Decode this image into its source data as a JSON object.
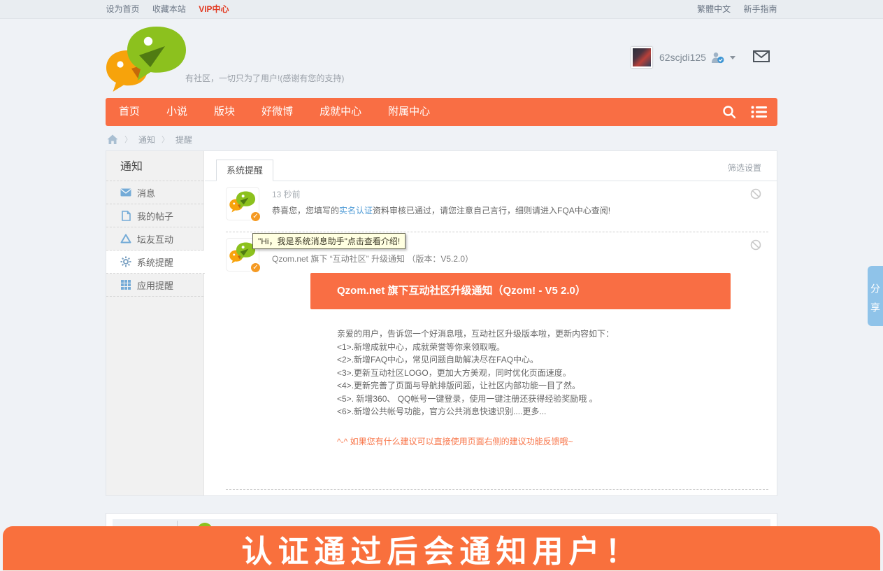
{
  "colors": {
    "accent_orange": "#f96e44",
    "link_blue": "#4f9bd6",
    "sidebar_icon_blue": "#74abd7",
    "share_tab_blue": "#8fc3e9",
    "vip_red": "#e23a21",
    "tooltip_bg": "#ffffe1",
    "page_bg": "#eff2f6"
  },
  "topbar": {
    "links_left": [
      "设为首页",
      "收藏本站",
      "VIP中心"
    ],
    "links_right": [
      "繁體中文",
      "新手指南"
    ]
  },
  "header": {
    "tagline": "有社区，一切只为了用户!(感谢有您的支持)",
    "username": "62scjdi125"
  },
  "nav": {
    "items": [
      "首页",
      "小说",
      "版块",
      "好微博",
      "成就中心",
      "附属中心"
    ]
  },
  "breadcrumb": {
    "level1": "通知",
    "level2": "提醒"
  },
  "sidebar": {
    "title": "通知",
    "items": [
      {
        "label": "消息",
        "icon": "envelope-icon",
        "active": false
      },
      {
        "label": "我的帖子",
        "icon": "document-icon",
        "active": false
      },
      {
        "label": "坛友互动",
        "icon": "recycle-icon",
        "active": false
      },
      {
        "label": "系统提醒",
        "icon": "gear-icon",
        "active": true
      },
      {
        "label": "应用提醒",
        "icon": "grid-icon",
        "active": false
      }
    ]
  },
  "main": {
    "tab_label": "系统提醒",
    "filter_label": "筛选设置",
    "notification1": {
      "time": "13 秒前",
      "text_before": "恭喜您，您填写的",
      "link_text": "实名认证",
      "text_after": "资料审核已通过，请您注意自己言行，细则请进入FQA中心查阅!"
    },
    "notification2": {
      "tooltip": "\"Hi，我是系统消息助手\"点击查看介绍!",
      "title": "Qzom.net 旗下 “互动社区” 升级通知 （版本：V5.2.0）",
      "banner_title": "Qzom.net 旗下互动社区升级通知（Qzom! - V5 2.0）",
      "body_lines": [
        "亲爱的用户，告诉您一个好消息哦，互动社区升级版本啦，更新内容如下：",
        "<1>.新增成就中心，成就荣誉等你来领取哦。",
        "<2>.新增FAQ中心，常见问题自助解决尽在FAQ中心。",
        "<3>.更新互动社区LOGO，更加大方美观，同时优化页面速度。",
        "<4>.更新完善了页面与导航排版问题，让社区内部功能一目了然。",
        "<5>. 新增360、 QQ帐号一键登录，使用一键注册还获得经验奖励哦 。",
        "<6>.新增公共帐号功能，官方公共消息快速识别....更多..."
      ],
      "note": "^-^ 如果您有什么建议可以直接使用页面右侧的建议功能反馈哦~"
    }
  },
  "share_tab": {
    "label": "分享"
  },
  "overlay_banner": {
    "text": "认证通过后会通知用户！"
  },
  "icons": {
    "search-icon": "magnifier",
    "list-icon": "bullet-list",
    "mail-icon": "envelope-outline",
    "home-icon": "house",
    "block-icon": "circle-slash",
    "verified-badge-icon": "user-with-check",
    "dropdown-caret-icon": "triangle-down",
    "envelope-icon": "filled-envelope",
    "document-icon": "page",
    "recycle-icon": "triangle-arrows",
    "gear-icon": "gear",
    "grid-icon": "3x3-grid",
    "check-badge-icon": "orange-circle-check",
    "logo-icon": "two-speech-bubbles"
  }
}
